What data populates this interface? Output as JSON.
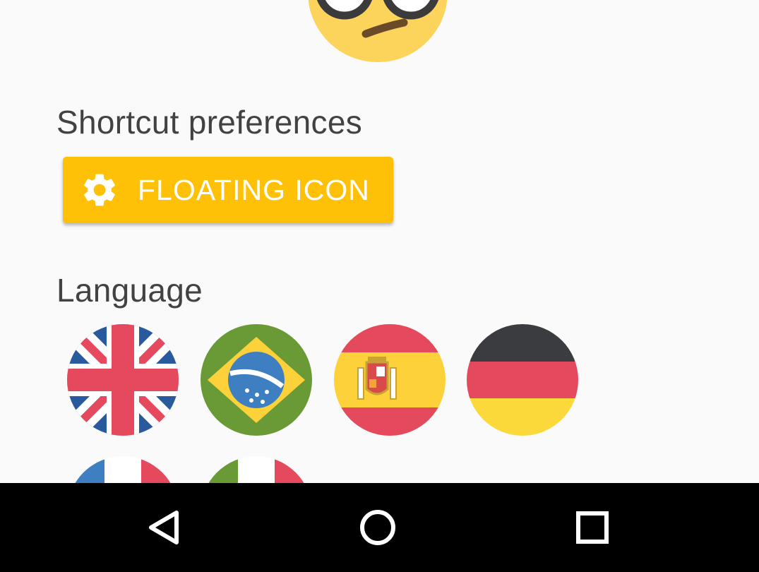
{
  "header": {
    "avatar_icon": "nerd-face-emoji"
  },
  "shortcut": {
    "title": "Shortcut preferences",
    "button_label": "FLOATING ICON",
    "button_icon": "gear-icon",
    "button_color": "#ffc107"
  },
  "language": {
    "title": "Language",
    "flags": [
      {
        "icon": "uk-flag-icon"
      },
      {
        "icon": "brazil-flag-icon"
      },
      {
        "icon": "spain-flag-icon"
      },
      {
        "icon": "germany-flag-icon"
      },
      {
        "icon": "france-flag-icon"
      },
      {
        "icon": "italy-flag-icon"
      }
    ]
  },
  "navbar": {
    "buttons": [
      {
        "icon": "back-icon"
      },
      {
        "icon": "home-icon"
      },
      {
        "icon": "recents-icon"
      }
    ]
  }
}
